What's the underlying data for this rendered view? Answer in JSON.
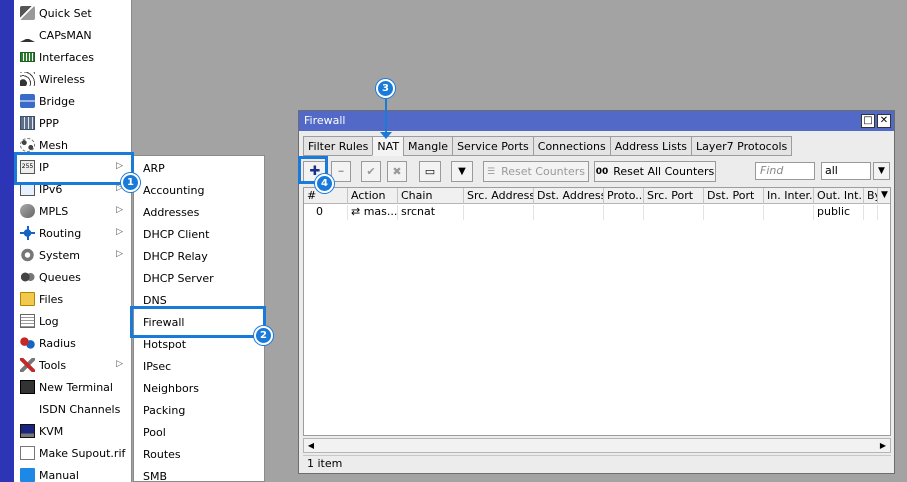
{
  "menu": {
    "items": [
      {
        "label": "Quick Set",
        "icon": "magic-wand-icon",
        "cls": "ic-wand"
      },
      {
        "label": "CAPsMAN",
        "icon": "capsman-icon",
        "cls": "ic-caps"
      },
      {
        "label": "Interfaces",
        "icon": "interfaces-icon",
        "cls": "ic-iface"
      },
      {
        "label": "Wireless",
        "icon": "wireless-icon",
        "cls": "ic-wifi"
      },
      {
        "label": "Bridge",
        "icon": "bridge-icon",
        "cls": "ic-bridge"
      },
      {
        "label": "PPP",
        "icon": "ppp-icon",
        "cls": "ic-ppp"
      },
      {
        "label": "Mesh",
        "icon": "mesh-icon",
        "cls": "ic-mesh"
      },
      {
        "label": "IP",
        "icon": "ip-icon",
        "cls": "ic-ip",
        "submenu": true
      },
      {
        "label": "IPv6",
        "icon": "ipv6-icon",
        "cls": "ic-ipv6",
        "submenu": true
      },
      {
        "label": "MPLS",
        "icon": "mpls-icon",
        "cls": "ic-mpls",
        "submenu": true
      },
      {
        "label": "Routing",
        "icon": "routing-icon",
        "cls": "ic-routing",
        "submenu": true
      },
      {
        "label": "System",
        "icon": "system-gear-icon",
        "cls": "ic-system",
        "submenu": true
      },
      {
        "label": "Queues",
        "icon": "queues-icon",
        "cls": "ic-queues"
      },
      {
        "label": "Files",
        "icon": "folder-icon",
        "cls": "ic-files"
      },
      {
        "label": "Log",
        "icon": "log-icon",
        "cls": "ic-log"
      },
      {
        "label": "Radius",
        "icon": "radius-icon",
        "cls": "ic-radius"
      },
      {
        "label": "Tools",
        "icon": "tools-icon",
        "cls": "ic-tools",
        "submenu": true
      },
      {
        "label": "New Terminal",
        "icon": "terminal-icon",
        "cls": "ic-term"
      },
      {
        "label": "ISDN Channels",
        "icon": "",
        "cls": ""
      },
      {
        "label": "KVM",
        "icon": "kvm-icon",
        "cls": "ic-kvm"
      },
      {
        "label": "Make Supout.rif",
        "icon": "supout-icon",
        "cls": "ic-supout"
      },
      {
        "label": "Manual",
        "icon": "manual-icon",
        "cls": "ic-manual"
      }
    ],
    "submenu_arrow": "▷"
  },
  "ip_submenu": {
    "items": [
      "ARP",
      "Accounting",
      "Addresses",
      "DHCP Client",
      "DHCP Relay",
      "DHCP Server",
      "DNS",
      "Firewall",
      "Hotspot",
      "IPsec",
      "Neighbors",
      "Packing",
      "Pool",
      "Routes",
      "SMB"
    ]
  },
  "badges": [
    "1",
    "2",
    "3",
    "4"
  ],
  "window": {
    "title": "Firewall",
    "restore_glyph": "□",
    "close_glyph": "✕",
    "tabs": [
      {
        "label": "Filter Rules",
        "active": false
      },
      {
        "label": "NAT",
        "active": true
      },
      {
        "label": "Mangle",
        "active": false
      },
      {
        "label": "Service Ports",
        "active": false
      },
      {
        "label": "Connections",
        "active": false
      },
      {
        "label": "Address Lists",
        "active": false
      },
      {
        "label": "Layer7 Protocols",
        "active": false
      }
    ],
    "toolbar": {
      "add_glyph": "✚",
      "remove_glyph": "━",
      "enable_glyph": "✔",
      "disable_glyph": "✖",
      "comment_glyph": "▭",
      "filter_glyph": "▼",
      "reset_counters": "Reset Counters",
      "reset_all_counters": "Reset All Counters",
      "reset_all_prefix": "00",
      "find_placeholder": "Find",
      "filter_value": "all",
      "dropdown_glyph": "▼"
    },
    "table": {
      "columns": [
        "#",
        "Action",
        "Chain",
        "Src. Address",
        "Dst. Address",
        "Proto...",
        "Src. Port",
        "Dst. Port",
        "In. Inter...",
        "Out. Int...",
        "By"
      ],
      "rows": [
        {
          "num": "0",
          "action": "⇄ mas...",
          "chain": "srcnat",
          "src": "",
          "dst": "",
          "proto": "",
          "sport": "",
          "dport": "",
          "in": "",
          "out": "public",
          "by": ""
        }
      ]
    },
    "status": "1 item"
  }
}
